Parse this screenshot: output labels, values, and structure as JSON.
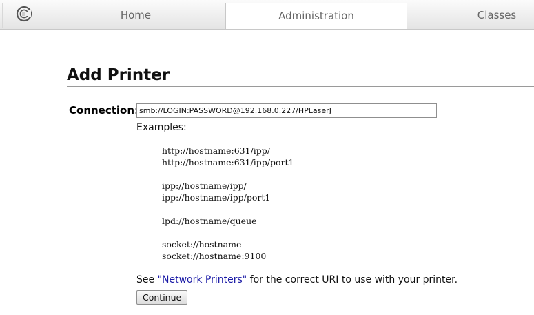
{
  "nav": {
    "logo": "cups-logo-icon",
    "tabs": [
      "Home",
      "Administration",
      "Classes"
    ],
    "active_tab": "Administration"
  },
  "page": {
    "title": "Add Printer"
  },
  "form": {
    "connection_label": "Connection:",
    "connection_value": "smb://LOGIN:PASSWORD@192.168.0.227/HPLaserJ",
    "examples_label": "Examples:",
    "examples": [
      "http://hostname:631/ipp/",
      "http://hostname:631/ipp/port1",
      "",
      "ipp://hostname/ipp/",
      "ipp://hostname/ipp/port1",
      "",
      "lpd://hostname/queue",
      "",
      "socket://hostname",
      "socket://hostname:9100"
    ],
    "see_prefix": "See ",
    "see_link": "\"Network Printers\"",
    "see_suffix": " for the correct URI to use with your printer.",
    "continue_label": "Continue"
  }
}
